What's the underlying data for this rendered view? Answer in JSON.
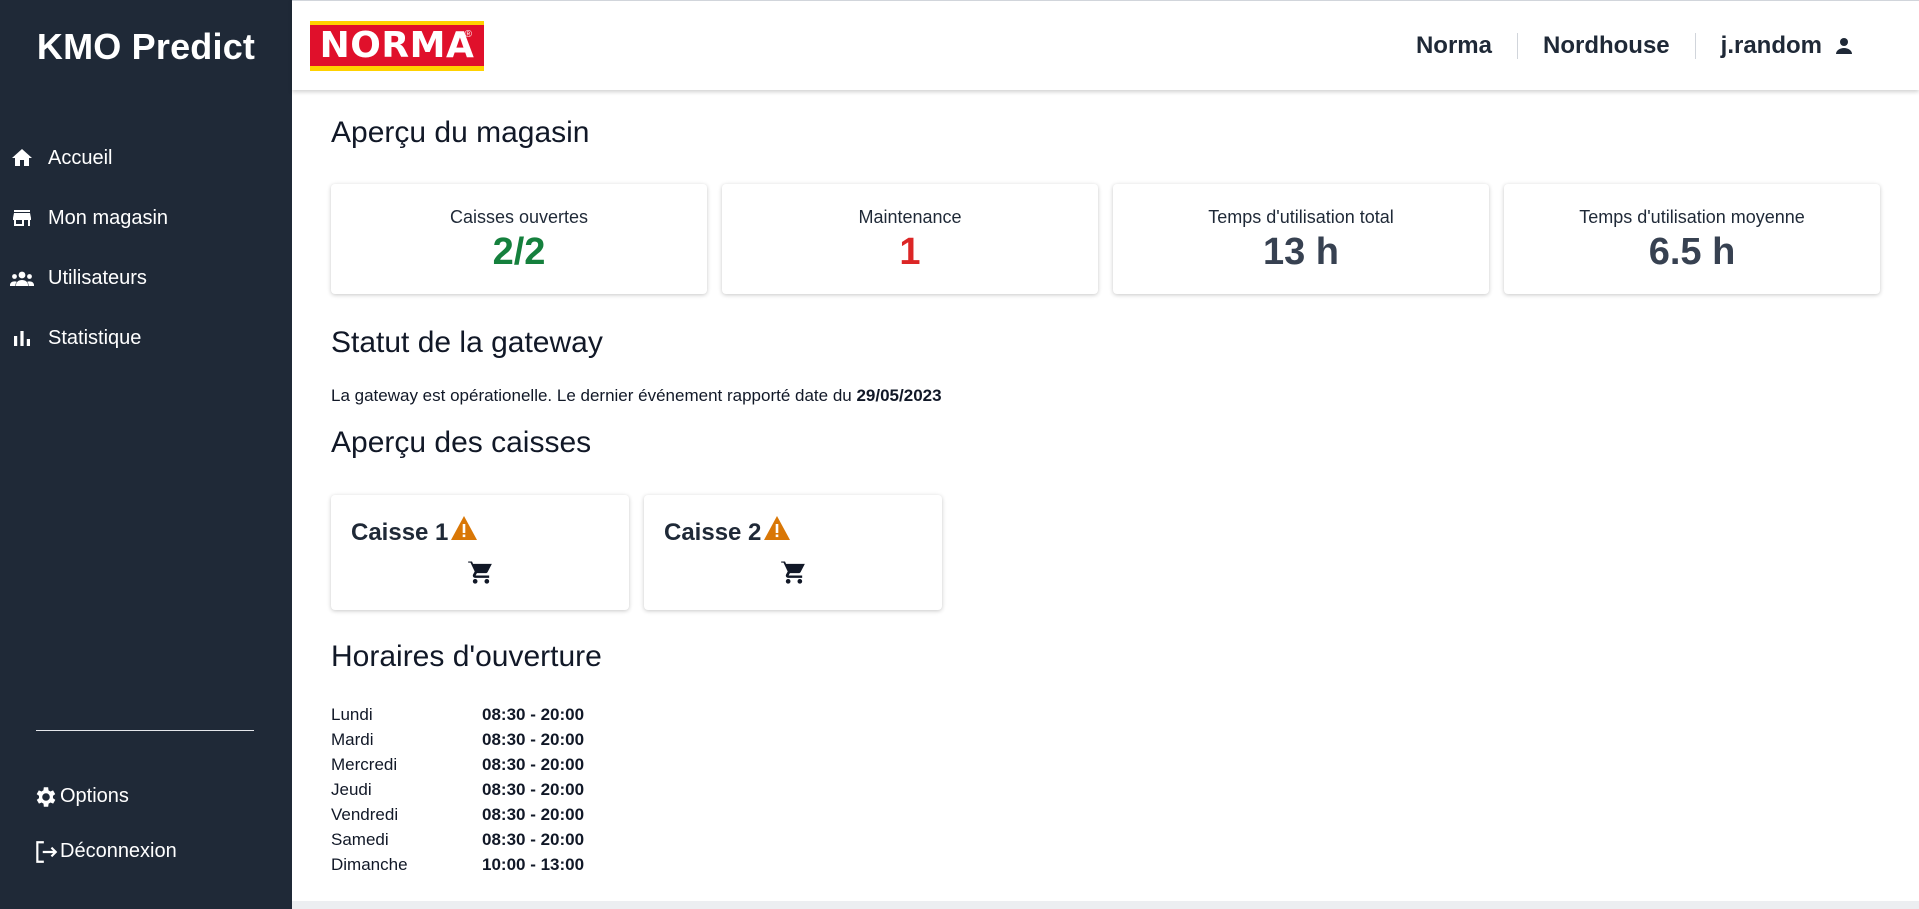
{
  "app": {
    "title": "KMO Predict"
  },
  "sidebar": {
    "items": [
      {
        "label": "Accueil",
        "icon": "home-icon"
      },
      {
        "label": "Mon magasin",
        "icon": "store-icon"
      },
      {
        "label": "Utilisateurs",
        "icon": "users-icon"
      },
      {
        "label": "Statistique",
        "icon": "bar-chart-icon"
      }
    ],
    "bottom": [
      {
        "label": "Options",
        "icon": "gear-icon"
      },
      {
        "label": "Déconnexion",
        "icon": "logout-icon"
      }
    ]
  },
  "header": {
    "logo_text": "NORMA",
    "logo_mark": "®",
    "brand": "Norma",
    "store": "Nordhouse",
    "user": "j.random",
    "colors": {
      "logo_red": "#e0102b",
      "logo_yellow": "#ffd200"
    }
  },
  "overview": {
    "title": "Aperçu du magasin",
    "stats": [
      {
        "label": "Caisses ouvertes",
        "value": "2/2",
        "color": "#15803d"
      },
      {
        "label": "Maintenance",
        "value": "1",
        "color": "#dc2626"
      },
      {
        "label": "Temps d'utilisation total",
        "value": "13 h",
        "color": "#374151"
      },
      {
        "label": "Temps d'utilisation moyenne",
        "value": "6.5 h",
        "color": "#374151"
      }
    ]
  },
  "gateway": {
    "title": "Statut de la gateway",
    "text": "La gateway est opérationelle. Le dernier événement rapporté date du ",
    "date": "29/05/2023"
  },
  "registers": {
    "title": "Aperçu des caisses",
    "items": [
      {
        "name": "Caisse 1",
        "status_icon": "warning-icon",
        "icon": "cart-icon"
      },
      {
        "name": "Caisse 2",
        "status_icon": "warning-icon",
        "icon": "cart-icon"
      }
    ],
    "warning_color": "#d97706"
  },
  "hours": {
    "title": "Horaires d'ouverture",
    "rows": [
      {
        "day": "Lundi",
        "time": "08:30 - 20:00"
      },
      {
        "day": "Mardi",
        "time": "08:30 - 20:00"
      },
      {
        "day": "Mercredi",
        "time": "08:30 - 20:00"
      },
      {
        "day": "Jeudi",
        "time": "08:30 - 20:00"
      },
      {
        "day": "Vendredi",
        "time": "08:30 - 20:00"
      },
      {
        "day": "Samedi",
        "time": "08:30 - 20:00"
      },
      {
        "day": "Dimanche",
        "time": "10:00 - 13:00"
      }
    ]
  }
}
